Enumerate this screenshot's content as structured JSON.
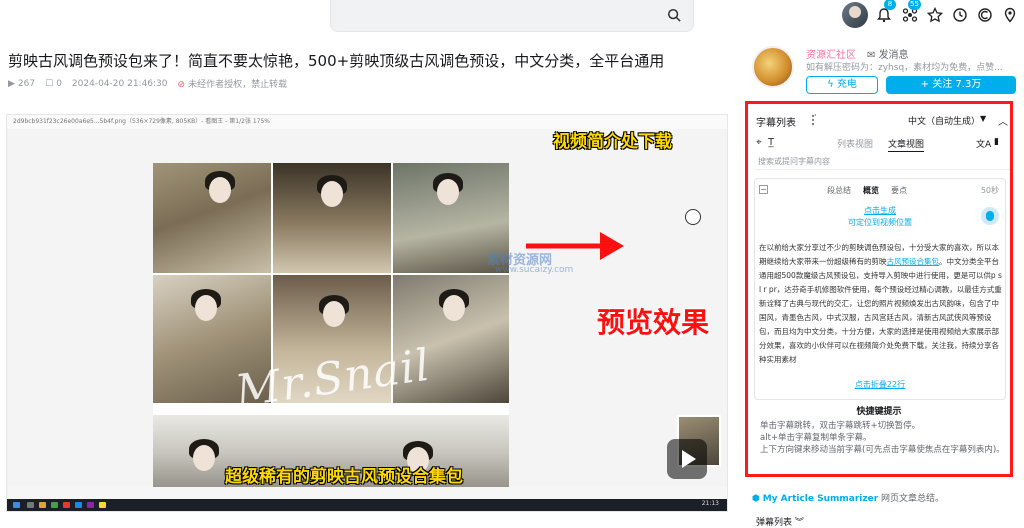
{
  "header": {
    "notification_count": "8",
    "dynamic_count": "55"
  },
  "video_meta": {
    "title": "剪映古风调色预设包来了！简直不要太惊艳，500+剪映顶级古风调色预设，中文分类，全平台通用",
    "views": "267",
    "comments": "0",
    "datetime": "2024-04-20 21:46:30",
    "notice": "未经作者授权，禁止转载"
  },
  "video": {
    "window_bar": "2d9bcb931f23c26e00a6e5...5b4f.png（536×729像素, 805KB）- 看图王 - 第1/2张 175%",
    "caption_top": "视频简介处下载",
    "caption_middle": "预览效果",
    "caption_bottom": "超级稀有的剪映古风预设合集包",
    "watermark_script": "Mr.Snail",
    "watermark_site": "素材资源网",
    "watermark_url": "www.sucaizy.com",
    "taskbar_time": "21:13"
  },
  "uploader": {
    "name": "资源汇社区",
    "message_label": "发消息",
    "signature": "如有解压密码为：zyhsq，素材均为免费，点赞...",
    "charge_label": "充电",
    "follow_label": "+ 关注 7.3万"
  },
  "subtitle_panel": {
    "title": "字幕列表",
    "language": "中文（自动生成）",
    "tab_list": "列表视图",
    "tab_article": "文章视图",
    "search_placeholder": "搜索或提问字幕内容",
    "tabs": [
      "段总结",
      "概览",
      "要点"
    ],
    "duration": "50秒",
    "generate": "点击生成",
    "locate": "可定位到视频位置",
    "body_part1": "在以前给大家分享过不少的剪映调色预设包，十分受大家的喜欢，所以本期继续给大家带来一份超级稀有的剪映",
    "body_link": "古风预设合集包",
    "body_part2": "。中文分类全平台通用超500款魔级古风预设包，支持导入剪映中进行使用，更是可以供p s l r pr，达芬奇手机修图软件使用，每个预设经过精心调教，以最佳方式重新诠释了古典与现代的交汇，让您的照片视频焕发出古风韵味，包含了中国风，青墨色古风，中式汉服，古风宫廷古风，清新古风武侠风等预设包，而且均为中文分类，十分方便，大家的选择是使用视频给大家展示部分效果，喜欢的小伙伴可以在视频简介处免费下载，关注我，持续分享各种实用素材",
    "fold": "点击折叠22行",
    "shortcut_title": "快捷键提示",
    "shortcuts": [
      "单击字幕跳转，双击字幕跳转+切换暂停。",
      "alt+单击字幕复制单条字幕。",
      "上下方向键来移动当前字幕(可先点击字幕使焦点在字幕列表内)。"
    ]
  },
  "extension": {
    "name": "My Article Summarizer",
    "desc": "网页文章总结。"
  },
  "bottom_tab": "弹幕列表"
}
